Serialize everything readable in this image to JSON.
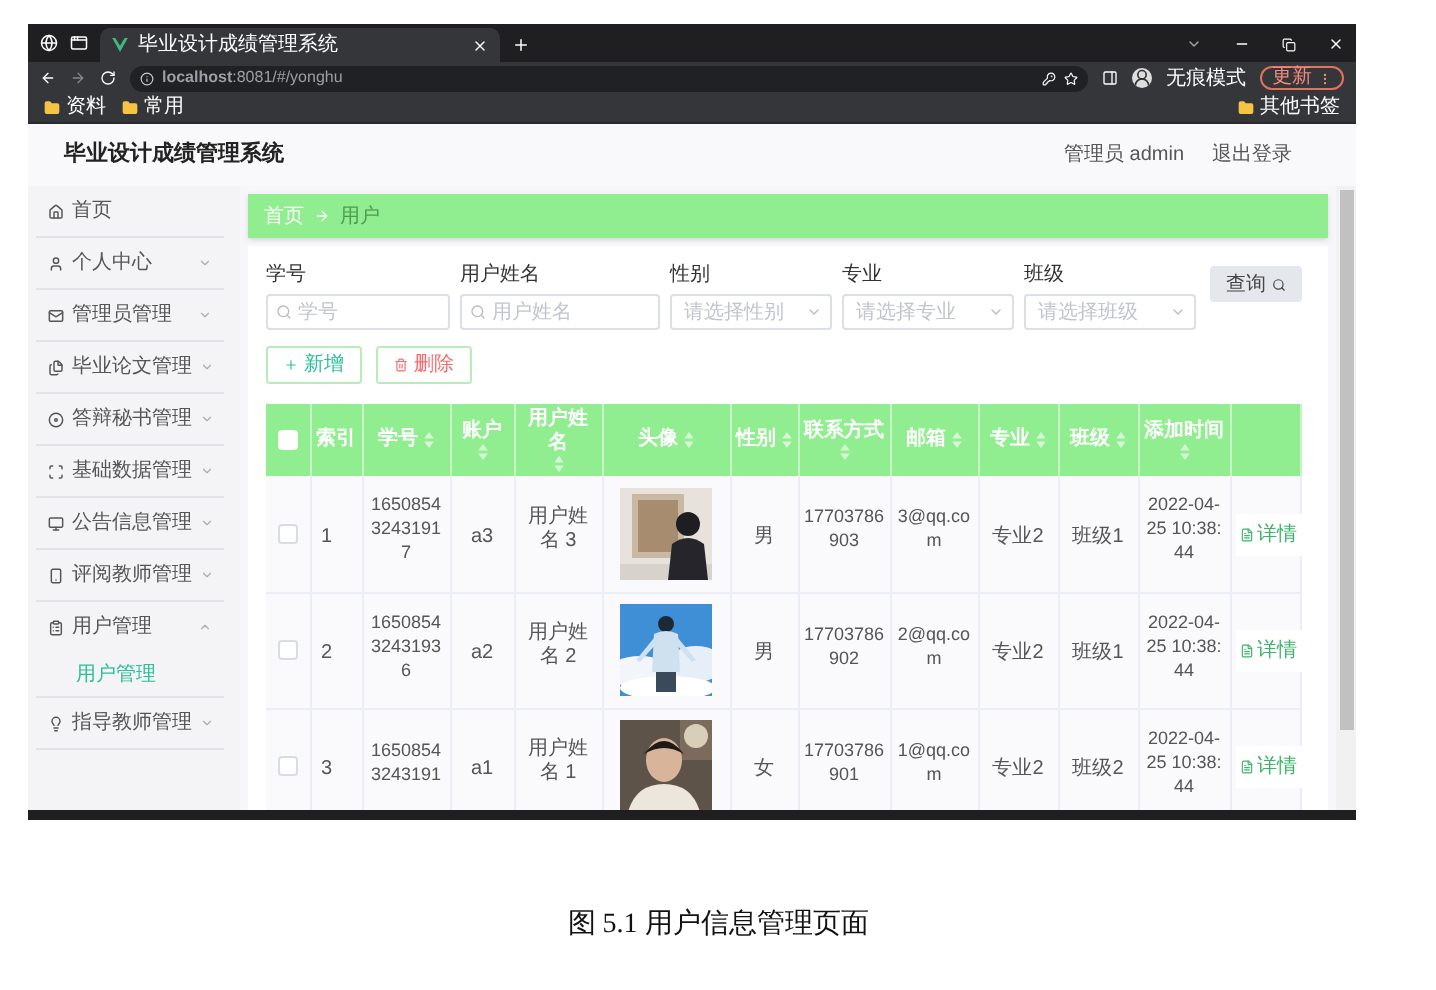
{
  "browser": {
    "tab_title": "毕业设计成绩管理系统",
    "url": "**localhost**:8081/#/yonghu",
    "profile_label": "无痕模式",
    "update_button": "更新",
    "bookmarks": [
      "资料",
      "常用"
    ],
    "other_bookmarks": "其他书签"
  },
  "header": {
    "title": "毕业设计成绩管理系统",
    "user": "管理员 admin",
    "logout": "退出登录"
  },
  "sidebar": {
    "items": [
      {
        "label": "首页",
        "expandable": false
      },
      {
        "label": "个人中心",
        "expandable": true,
        "expanded": false
      },
      {
        "label": "管理员管理",
        "expandable": true,
        "expanded": false
      },
      {
        "label": "毕业论文管理",
        "expandable": true,
        "expanded": false
      },
      {
        "label": "答辩秘书管理",
        "expandable": true,
        "expanded": false
      },
      {
        "label": "基础数据管理",
        "expandable": true,
        "expanded": false
      },
      {
        "label": "公告信息管理",
        "expandable": true,
        "expanded": false
      },
      {
        "label": "评阅教师管理",
        "expandable": true,
        "expanded": false
      },
      {
        "label": "用户管理",
        "expandable": true,
        "expanded": true,
        "children": [
          {
            "label": "用户管理",
            "selected": true
          }
        ]
      },
      {
        "label": "指导教师管理",
        "expandable": true,
        "expanded": false
      }
    ]
  },
  "breadcrumb": [
    "首页",
    "用户"
  ],
  "filters": [
    {
      "label": "学号",
      "placeholder": "学号",
      "kind": "text"
    },
    {
      "label": "用户姓名",
      "placeholder": "用户姓名",
      "kind": "text"
    },
    {
      "label": "性别",
      "placeholder": "请选择性别",
      "kind": "select"
    },
    {
      "label": "专业",
      "placeholder": "请选择专业",
      "kind": "select"
    },
    {
      "label": "班级",
      "placeholder": "请选择班级",
      "kind": "select"
    }
  ],
  "search_button": "查询",
  "actions": {
    "add": "新增",
    "delete": "删除"
  },
  "table": {
    "columns": [
      {
        "kind": "checkbox",
        "checked": false
      },
      {
        "kind": "text",
        "label": "索引",
        "sortable": false
      },
      {
        "kind": "text",
        "label": "学号",
        "sortable": true
      },
      {
        "kind": "text",
        "label": "账户",
        "sortable": true
      },
      {
        "kind": "text",
        "label": "用户姓名",
        "sortable": true
      },
      {
        "kind": "picture",
        "label": "头像",
        "sortable": true
      },
      {
        "kind": "text",
        "label": "性别",
        "sortable": true
      },
      {
        "kind": "text",
        "label": "联系方式",
        "sortable": true
      },
      {
        "kind": "text",
        "label": "邮箱",
        "sortable": true
      },
      {
        "kind": "text",
        "label": "专业",
        "sortable": true
      },
      {
        "kind": "text",
        "label": "班级",
        "sortable": true
      },
      {
        "kind": "text",
        "label": "添加时间",
        "sortable": true
      },
      {
        "kind": "actions"
      }
    ],
    "rows": [
      {
        "cells": [
          {
            "kind": "checkbox",
            "checked": false
          },
          "1",
          "16508543243191 7",
          "a3",
          "用户姓名 3",
          {
            "kind": "picture"
          },
          "男",
          "17703786903",
          "3@qq.com",
          "专业2",
          "班级1",
          "2022-04-25 10:38:44",
          {
            "kind": "action",
            "label": "详情"
          }
        ]
      },
      {
        "cells": [
          {
            "kind": "checkbox",
            "checked": false
          },
          "2",
          "16508543243193 6",
          "a2",
          "用户姓名 2",
          {
            "kind": "picture"
          },
          "男",
          "17703786902",
          "2@qq.com",
          "专业2",
          "班级1",
          "2022-04-25 10:38:44",
          {
            "kind": "action",
            "label": "详情"
          }
        ]
      },
      {
        "cells": [
          {
            "kind": "checkbox",
            "checked": false
          },
          "3",
          "16508543243191",
          "a1",
          "用户姓名 1",
          {
            "kind": "picture"
          },
          "女",
          "17703786901",
          "1@qq.com",
          "专业2",
          "班级2",
          "2022-04-25 10:38:44",
          {
            "kind": "action",
            "label": "详情"
          }
        ]
      }
    ]
  },
  "caption": "图 5.1 用户信息管理页面"
}
